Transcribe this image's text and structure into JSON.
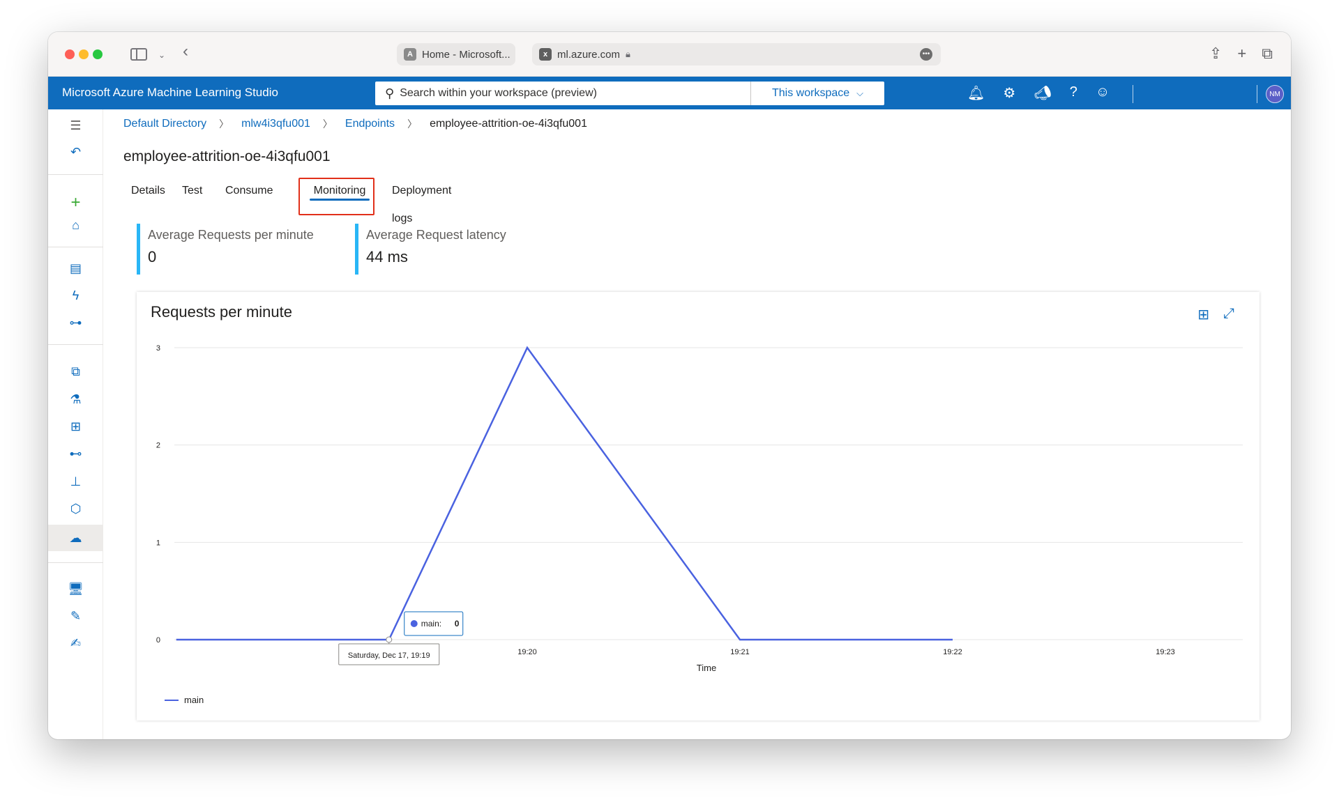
{
  "browser": {
    "tabs": [
      {
        "favicon": "A",
        "label": "Home - Microsoft..."
      },
      {
        "favicon": "x",
        "label": "ml.azure.com"
      }
    ]
  },
  "header": {
    "app_title": "Microsoft Azure Machine Learning Studio",
    "search_placeholder": "Search within your workspace (preview)",
    "scope_label": "This workspace",
    "user_initials": "NM"
  },
  "breadcrumb": {
    "items": [
      "Default Directory",
      "mlw4i3qfu001",
      "Endpoints",
      "employee-attrition-oe-4i3qfu001"
    ]
  },
  "page": {
    "title": "employee-attrition-oe-4i3qfu001",
    "tabs": [
      "Details",
      "Test",
      "Consume",
      "Monitoring",
      "Deployment logs"
    ],
    "active_tab": "Monitoring"
  },
  "metrics": [
    {
      "label": "Average Requests per minute",
      "value": "0"
    },
    {
      "label": "Average Request latency",
      "value": "44 ms"
    }
  ],
  "chart_data": {
    "type": "line",
    "title": "Requests per minute",
    "xlabel": "Time",
    "ylabel": "",
    "x_ticks": [
      "19:20",
      "19:21",
      "19:22",
      "19:23"
    ],
    "y_ticks": [
      0,
      1,
      2,
      3
    ],
    "ylim": [
      0,
      3
    ],
    "series": [
      {
        "name": "main",
        "color": "#4a62e0",
        "points": [
          {
            "x": "19:18.4",
            "t": -1.65,
            "y": 0
          },
          {
            "x": "19:19",
            "t": -0.65,
            "y": 0
          },
          {
            "x": "19:20",
            "t": 0,
            "y": 3
          },
          {
            "x": "19:21",
            "t": 1,
            "y": 0
          },
          {
            "x": "19:22",
            "t": 2,
            "y": 0
          }
        ]
      }
    ],
    "tooltip": {
      "series_label": "main:",
      "value": "0",
      "time_label": "Saturday, Dec 17, 19:19"
    },
    "legend_position": "bottom-left",
    "grid": true
  }
}
